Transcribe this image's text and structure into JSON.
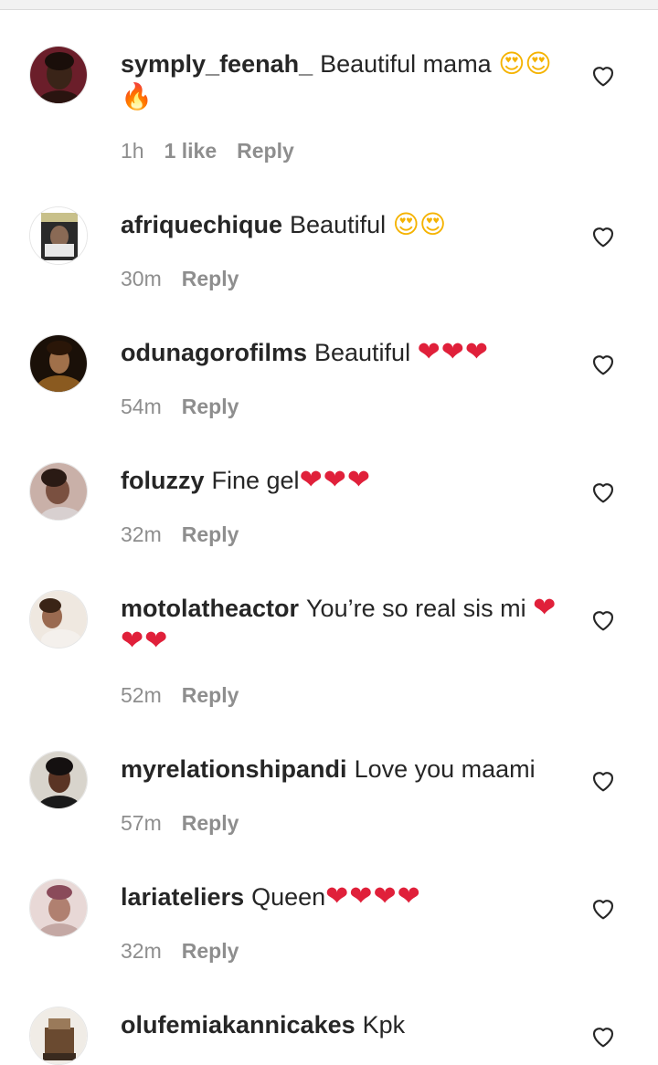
{
  "comments": [
    {
      "user": "symply_feenah_",
      "text": "Beautiful mama",
      "emojis": "😍😍🔥",
      "time": "1h",
      "likes": "1 like",
      "reply": "Reply"
    },
    {
      "user": "afriquechique",
      "text": "Beautiful",
      "emojis": "😍😍",
      "time": "30m",
      "reply": "Reply"
    },
    {
      "user": "odunagorofilms",
      "text": "Beautiful",
      "emojis": "❤❤❤",
      "time": "54m",
      "reply": "Reply"
    },
    {
      "user": "foluzzy",
      "text": "Fine gel",
      "emojis": "❤❤❤",
      "time": "32m",
      "reply": "Reply"
    },
    {
      "user": "motolatheactor",
      "text": "You’re so real sis mi",
      "emojis": "❤❤❤",
      "time": "52m",
      "reply": "Reply"
    },
    {
      "user": "myrelationshipandi",
      "text": "Love you maami",
      "time": "57m",
      "reply": "Reply"
    },
    {
      "user": "lariateliers",
      "text": "Queen",
      "emojis": "❤❤❤❤",
      "time": "32m",
      "reply": "Reply"
    },
    {
      "user": "olufemiakannicakes",
      "text": "Kpk"
    }
  ],
  "colors": {
    "text": "#262626",
    "meta": "#8e8e8e",
    "heart_emoji": "#e0203a",
    "divider": "#dbdbdb"
  },
  "icons": {
    "like": "heart-outline-icon"
  }
}
